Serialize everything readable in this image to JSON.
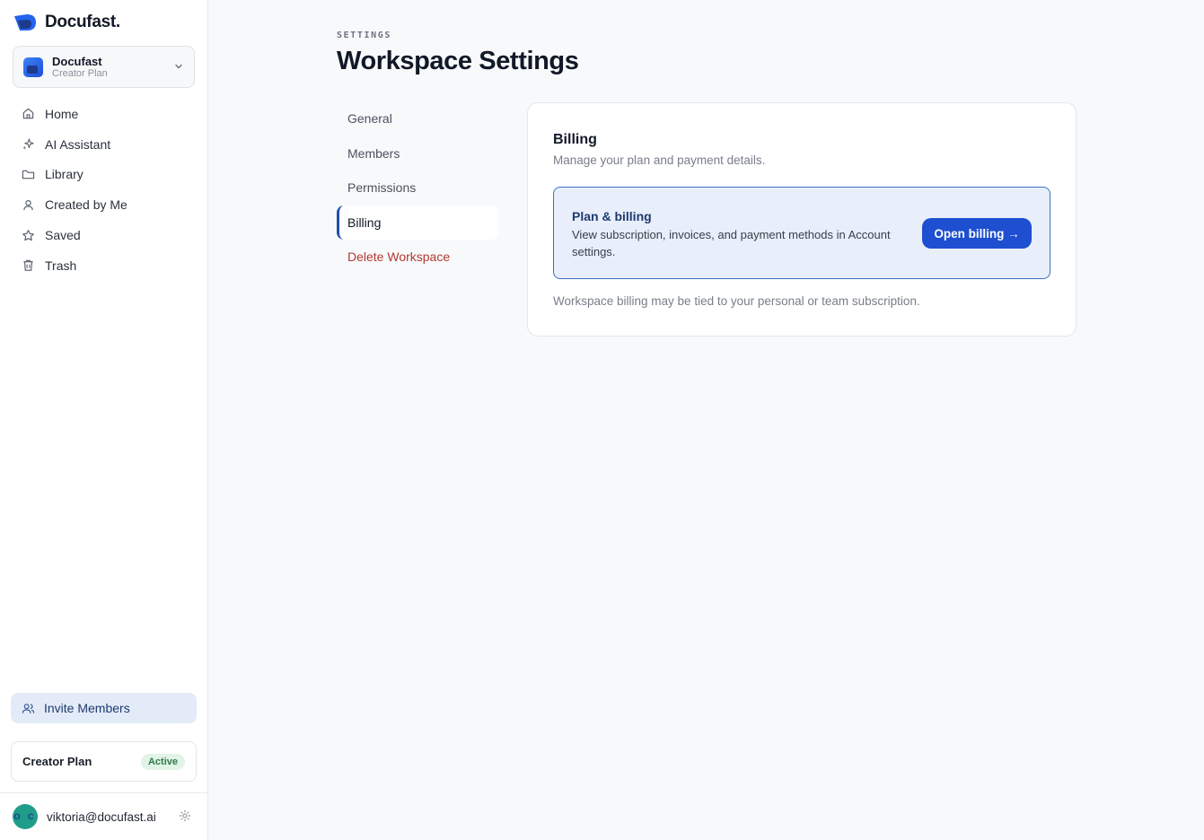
{
  "brand": {
    "name": "Docufast."
  },
  "workspace": {
    "name": "Docufast",
    "plan": "Creator Plan"
  },
  "nav": {
    "items": [
      {
        "label": "Home",
        "icon": "home-icon"
      },
      {
        "label": "AI Assistant",
        "icon": "sparkle-icon"
      },
      {
        "label": "Library",
        "icon": "folder-icon"
      },
      {
        "label": "Created by Me",
        "icon": "user-icon"
      },
      {
        "label": "Saved",
        "icon": "star-icon"
      },
      {
        "label": "Trash",
        "icon": "trash-icon"
      }
    ]
  },
  "invite": {
    "label": "Invite Members",
    "icon": "users-icon"
  },
  "plan_card": {
    "name": "Creator Plan",
    "status": "Active"
  },
  "user": {
    "email": "viktoria@docufast.ai",
    "avatar_text": "O C"
  },
  "header": {
    "eyebrow": "SETTINGS",
    "title": "Workspace Settings"
  },
  "tabs": [
    {
      "label": "General"
    },
    {
      "label": "Members"
    },
    {
      "label": "Permissions"
    },
    {
      "label": "Billing"
    },
    {
      "label": "Delete Workspace"
    }
  ],
  "billing": {
    "title": "Billing",
    "subtitle": "Manage your plan and payment details.",
    "box_title": "Plan & billing",
    "box_desc": "View subscription, invoices, and payment methods in Account settings.",
    "button_label": "Open billing →",
    "note": "Workspace billing may be tied to your personal or team subscription."
  },
  "colors": {
    "accent": "#1d4fd0",
    "danger": "#b3392f",
    "active_badge": "#2f7a4a"
  }
}
